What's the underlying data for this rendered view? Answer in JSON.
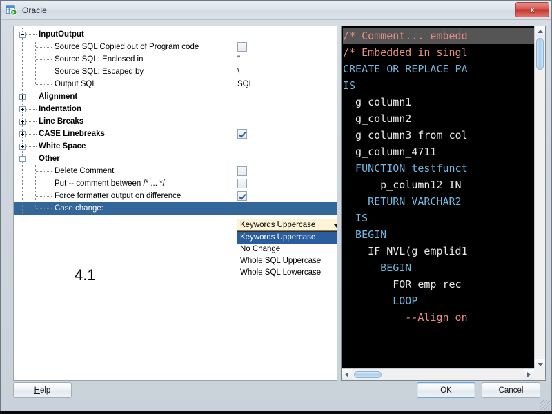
{
  "window": {
    "title": "Oracle",
    "app_icon": "database-run-icon",
    "close_label": "x"
  },
  "tree": {
    "groups": [
      {
        "label": "InputOutput",
        "expanded": true,
        "expander": "minus",
        "children": [
          {
            "label": "Source SQL Copied out of Program code",
            "value_type": "checkbox",
            "checked": false
          },
          {
            "label": "Source SQL: Enclosed in",
            "value_type": "text",
            "value": "\""
          },
          {
            "label": "Source SQL: Escaped by",
            "value_type": "text",
            "value": "\\"
          },
          {
            "label": "Output SQL",
            "value_type": "text",
            "value": "SQL"
          }
        ]
      },
      {
        "label": "Alignment",
        "expanded": false,
        "expander": "plus",
        "children": []
      },
      {
        "label": "Indentation",
        "expanded": false,
        "expander": "plus",
        "children": []
      },
      {
        "label": "Line Breaks",
        "expanded": false,
        "expander": "plus",
        "children": []
      },
      {
        "label": "CASE Linebreaks",
        "expanded": false,
        "expander": "plus",
        "value_type": "checkbox",
        "checked": true,
        "children": []
      },
      {
        "label": "White Space",
        "expanded": false,
        "expander": "plus",
        "children": []
      },
      {
        "label": "Other",
        "expanded": true,
        "expander": "minus",
        "children": [
          {
            "label": "Delete Comment",
            "value_type": "checkbox",
            "checked": false
          },
          {
            "label": "Put -- comment between /* ... */",
            "value_type": "checkbox",
            "checked": false
          },
          {
            "label": "Force formatter output on difference",
            "value_type": "checkbox",
            "checked": true
          },
          {
            "label": "Case change:",
            "value_type": "combobox",
            "selected": true
          }
        ]
      }
    ],
    "version_label": "4.1"
  },
  "combobox": {
    "value": "Keywords Uppercase",
    "open": true,
    "options": [
      {
        "label": "Keywords Uppercase",
        "selected": true
      },
      {
        "label": "No Change",
        "selected": false
      },
      {
        "label": "Whole SQL Uppercase",
        "selected": false
      },
      {
        "label": "Whole SQL Lowercase",
        "selected": false
      }
    ]
  },
  "preview": {
    "lines": [
      {
        "text": "/* Comment... embedd",
        "kind": "comment",
        "highlighted": true
      },
      {
        "text": "/* Embedded in singl",
        "kind": "comment",
        "highlighted": false
      },
      {
        "text": "CREATE OR REPLACE PA",
        "kind": "keyword",
        "highlighted": false
      },
      {
        "text": "IS",
        "kind": "keyword",
        "highlighted": false
      },
      {
        "text": "  g_column1",
        "kind": "ident",
        "highlighted": false
      },
      {
        "text": "  g_column2",
        "kind": "ident",
        "highlighted": false
      },
      {
        "text": "  g_column3_from_col",
        "kind": "ident",
        "highlighted": false
      },
      {
        "text": "  g_column_4711",
        "kind": "ident",
        "highlighted": false
      },
      {
        "text": "  FUNCTION testfunct",
        "kind": "keyword",
        "highlighted": false
      },
      {
        "text": "      p_column12 IN",
        "kind": "ident",
        "highlighted": false
      },
      {
        "text": "    RETURN VARCHAR2",
        "kind": "keyword",
        "highlighted": false
      },
      {
        "text": "  IS",
        "kind": "keyword",
        "highlighted": false
      },
      {
        "text": "  BEGIN",
        "kind": "keyword",
        "highlighted": false
      },
      {
        "text": "    IF NVL(g_emplid1",
        "kind": "ident",
        "highlighted": false
      },
      {
        "text": "      BEGIN",
        "kind": "keyword",
        "highlighted": false
      },
      {
        "text": "        FOR emp_rec",
        "kind": "ident",
        "highlighted": false
      },
      {
        "text": "        LOOP",
        "kind": "keyword",
        "highlighted": false
      },
      {
        "text": "          --Align on",
        "kind": "comment",
        "highlighted": false
      }
    ],
    "vscroll_label": "preview-vertical-scrollbar",
    "hscroll_label": "preview-horizontal-scrollbar"
  },
  "buttons": {
    "help": "Help",
    "help_mnemonic": "H",
    "ok": "OK",
    "cancel": "Cancel"
  },
  "colors": {
    "selection_blue": "#336699",
    "dropdown_selection": "#2a5d9e",
    "combo_background": "#fdf3d6",
    "code_background": "#000000",
    "comment": "#e88d82",
    "keyword": "#6fb8e0",
    "identifier": "#e8e8e8"
  }
}
